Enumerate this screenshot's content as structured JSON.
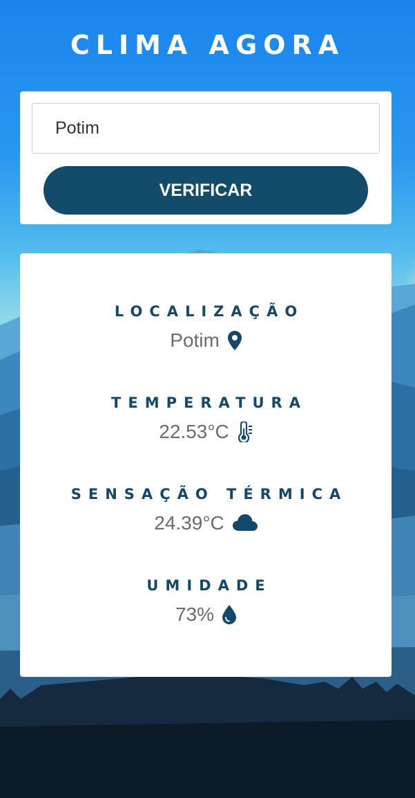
{
  "header": {
    "title": "CLIMA AGORA"
  },
  "search": {
    "city_value": "Potim",
    "button_label": "VERIFICAR"
  },
  "weather": {
    "location": {
      "label": "LOCALIZAÇÃO",
      "value": "Potim",
      "icon": "map-pin-icon"
    },
    "temperature": {
      "label": "TEMPERATURA",
      "value": "22.53°C",
      "icon": "thermometer-icon"
    },
    "feels_like": {
      "label": "SENSAÇÃO TÉRMICA",
      "value": "24.39°C",
      "icon": "cloud-icon"
    },
    "humidity": {
      "label": "UMIDADE",
      "value": "73%",
      "icon": "water-drop-icon"
    }
  },
  "colors": {
    "accent": "#134b6b",
    "label": "#14486b",
    "sky_top": "#1a84ee",
    "sky_mid": "#5fc6ee"
  }
}
